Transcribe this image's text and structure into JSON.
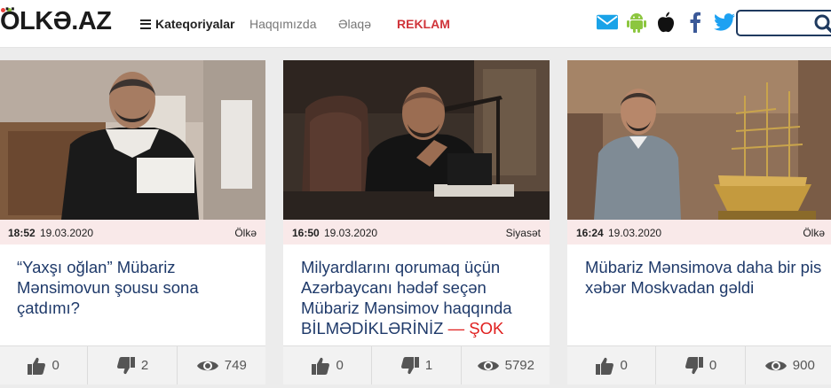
{
  "header": {
    "logo_text": "ÖLKƏ.AZ",
    "nav": {
      "categories_label": "Kateqoriyalar",
      "about_label": "Haqqımızda",
      "contact_label": "Əlaqə",
      "ads_label": "REKLAM"
    },
    "social_icons": [
      "mail-icon",
      "android-icon",
      "apple-icon",
      "facebook-icon",
      "twitter-icon"
    ],
    "search": {
      "placeholder": "",
      "icon": "search-icon"
    }
  },
  "colors": {
    "accent_navy": "#1f3a6a",
    "reklam_red": "#d0343a",
    "meta_bg": "#f9e9e9",
    "hot_red": "#e0201f"
  },
  "cards": [
    {
      "time": "18:52",
      "date": "19.03.2020",
      "category": "Ölkə",
      "title": "“Yaxşı oğlan” Mübariz Mənsimovun şousu sona çatdımı?",
      "title_hot": "",
      "likes": "0",
      "dislikes": "2",
      "views": "749"
    },
    {
      "time": "16:50",
      "date": "19.03.2020",
      "category": "Siyasət",
      "title": "Milyardlarını qorumaq üçün Azərbaycanı hədəf seçən Mübariz Mənsimov haqqında BİLMƏDİKLƏRİNİZ ",
      "title_hot": "— ŞOK",
      "likes": "0",
      "dislikes": "1",
      "views": "5792"
    },
    {
      "time": "16:24",
      "date": "19.03.2020",
      "category": "Ölkə",
      "title": "Mübariz Mənsimova daha bir pis xəbər Moskvadan gəldi",
      "title_hot": "",
      "likes": "0",
      "dislikes": "0",
      "views": "900"
    }
  ]
}
